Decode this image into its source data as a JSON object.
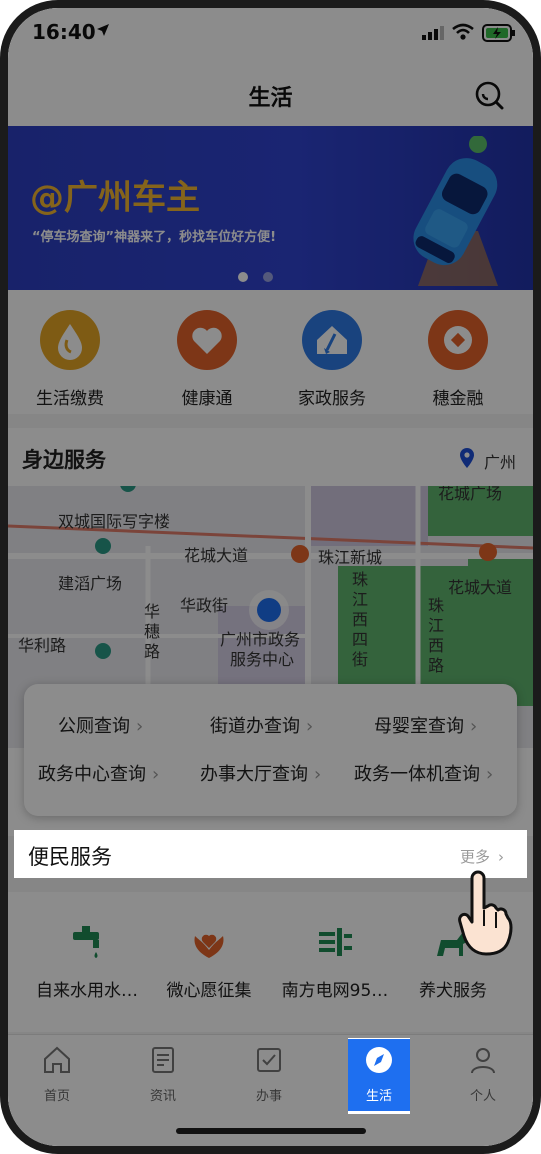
{
  "status_bar": {
    "time": "16:40"
  },
  "nav": {
    "title": "生活"
  },
  "banner": {
    "title": "@广州车主",
    "subtitle": "“停车场查询”神器来了，秒找车位好方便!",
    "slide_count": 3,
    "active_slide": 0
  },
  "quick_services": [
    {
      "label": "生活缴费",
      "icon": "water-drop-icon",
      "color": "#e6a626"
    },
    {
      "label": "健康通",
      "icon": "heart-icon",
      "color": "#e4632a"
    },
    {
      "label": "家政服务",
      "icon": "house-broom-icon",
      "color": "#2f7be6"
    },
    {
      "label": "穗金融",
      "icon": "coin-icon",
      "color": "#e4632a"
    }
  ],
  "nearby": {
    "title": "身边服务",
    "city": "广州",
    "map_labels": {
      "building1": "双城国际写字楼",
      "road1": "花城大道",
      "station1": "珠江新城",
      "road2": "花城大道",
      "place1": "建滔广场",
      "road3": "华政街",
      "place2": "广州市政务",
      "place3": "服务中心",
      "road4": "华利路",
      "vroad1": "华穗路",
      "vroad2": "珠江西四街",
      "vroad3": "珠江西路",
      "top_right": "花城广场"
    },
    "queries": [
      {
        "label": "公厕查询"
      },
      {
        "label": "街道办查询"
      },
      {
        "label": "母婴室查询"
      },
      {
        "label": "政务中心查询"
      },
      {
        "label": "办事大厅查询"
      },
      {
        "label": "政务一体机查询"
      }
    ]
  },
  "convenience": {
    "title": "便民服务",
    "more": "更多",
    "items": [
      {
        "label": "自来水用水…",
        "icon": "faucet-icon"
      },
      {
        "label": "微心愿征集",
        "icon": "lotus-heart-icon"
      },
      {
        "label": "南方电网95…",
        "icon": "power-grid-icon"
      },
      {
        "label": "养犬服务",
        "icon": "dog-icon"
      }
    ]
  },
  "tabs": [
    {
      "label": "首页",
      "icon": "home-icon"
    },
    {
      "label": "资讯",
      "icon": "news-icon"
    },
    {
      "label": "办事",
      "icon": "checkbox-icon"
    },
    {
      "label": "生活",
      "icon": "compass-icon",
      "active": true
    },
    {
      "label": "个人",
      "icon": "person-icon"
    }
  ],
  "colors": {
    "accent": "#1e6ff0",
    "banner": "#2d3fc2",
    "banner_title": "#f2b632"
  }
}
